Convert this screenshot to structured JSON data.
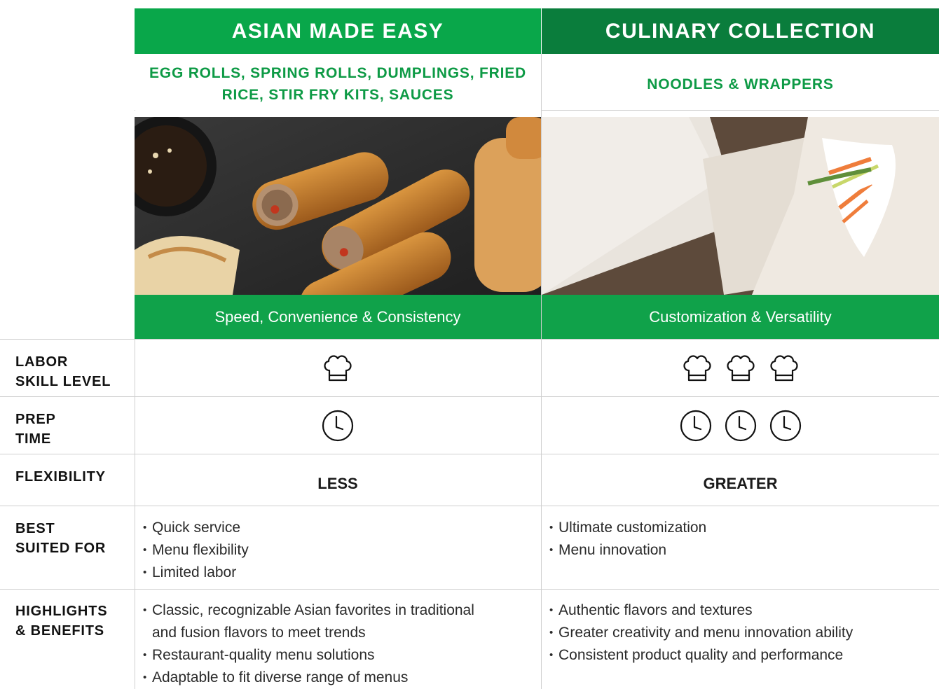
{
  "columns": [
    {
      "title": "ASIAN MADE EASY",
      "subtitle_lines": [
        "EGG ROLLS, SPRING ROLLS, DUMPLINGS, FRIED",
        "RICE, STIR FRY KITS, SAUCES"
      ],
      "band": "Speed, Convenience & Consistency",
      "flexibility": "LESS",
      "chef_hat_count": 1,
      "clock_count": 1,
      "best_suited": [
        "Quick service",
        "Menu flexibility",
        "Limited labor"
      ],
      "highlights": [
        "Classic, recognizable Asian favorites in traditional",
        "and fusion flavors to meet trends",
        "Restaurant-quality menu solutions",
        "Adaptable to fit diverse range of menus"
      ],
      "header_color": "#09a74a"
    },
    {
      "title": "CULINARY COLLECTION",
      "subtitle_lines": [
        "NOODLES & WRAPPERS"
      ],
      "band": "Customization & Versatility",
      "flexibility": "GREATER",
      "chef_hat_count": 3,
      "clock_count": 3,
      "best_suited": [
        "Ultimate customization",
        "Menu innovation"
      ],
      "highlights": [
        "Authentic flavors and textures",
        "Greater creativity and menu innovation ability",
        "Consistent product quality and performance"
      ],
      "header_color": "#0a7d3c"
    }
  ],
  "rows": {
    "labor": [
      "LABOR",
      "SKILL LEVEL"
    ],
    "prep": [
      "PREP",
      "TIME"
    ],
    "flexibility": [
      "FLEXIBILITY"
    ],
    "best": [
      "BEST",
      "SUITED FOR"
    ],
    "highlights": [
      "HIGHLIGHTS",
      "& BENEFITS"
    ]
  },
  "icons": {
    "labor": "chef-hat-icon",
    "prep": "clock-icon"
  },
  "colors": {
    "green": "#10a24a",
    "dark_green": "#0a7d3c",
    "text_green": "#0d9a45"
  }
}
